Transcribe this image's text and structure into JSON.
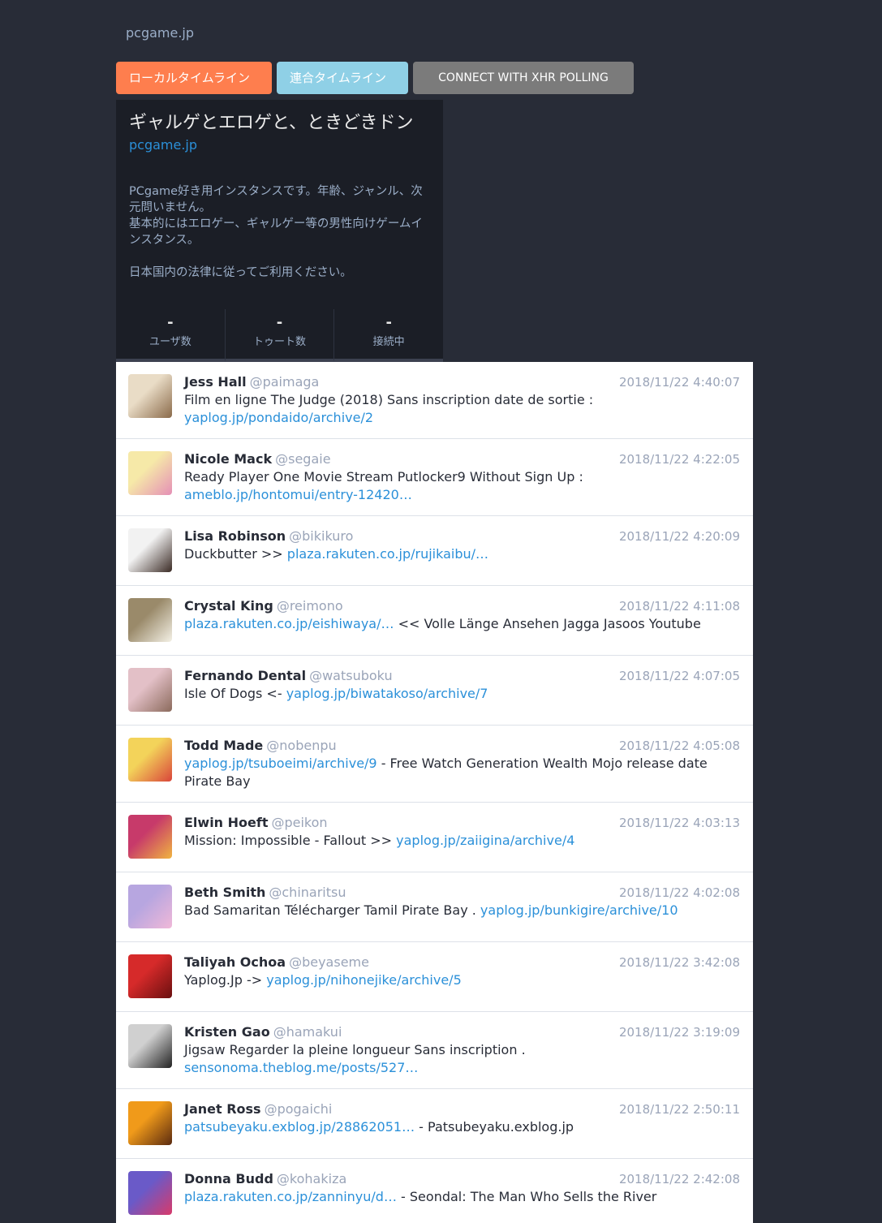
{
  "site": {
    "name": "pcgame.jp"
  },
  "tabs": {
    "local": "ローカルタイムライン",
    "federated": "連合タイムライン",
    "connect": "CONNECT WITH XHR POLLING"
  },
  "instance": {
    "title": "ギャルゲとエロゲと、ときどきドン",
    "link": "pcgame.jp",
    "desc_line1": "PCgame好き用インスタンスです。年齢、ジャンル、次元問いません。",
    "desc_line2": "基本的にはエロゲー、ギャルゲー等の男性向けゲームインスタンス。",
    "desc_line3": "日本国内の法律に従ってご利用ください。",
    "stats": [
      {
        "value": "-",
        "label": "ユーザ数"
      },
      {
        "value": "-",
        "label": "トゥート数"
      },
      {
        "value": "-",
        "label": "接続中"
      }
    ]
  },
  "statuses": [
    {
      "name": "Jess Hall",
      "acct": "@paimaga",
      "time": "2018/11/22 4:40:07",
      "parts": [
        {
          "t": "text",
          "v": "Film en ligne The Judge (2018) Sans inscription date de sortie : "
        },
        {
          "t": "link",
          "v": "yaplog.jp/pondaido/archive/2"
        }
      ],
      "avatar": [
        "#e9dcc6",
        "#8a6a4a"
      ]
    },
    {
      "name": "Nicole Mack",
      "acct": "@segaie",
      "time": "2018/11/22 4:22:05",
      "parts": [
        {
          "t": "text",
          "v": "Ready Player One Movie Stream Putlocker9 Without Sign Up : "
        },
        {
          "t": "link",
          "v": "ameblo.jp/hontomui/entry-12420…"
        }
      ],
      "avatar": [
        "#f6e9a8",
        "#e58fb6"
      ]
    },
    {
      "name": "Lisa Robinson",
      "acct": "@bikikuro",
      "time": "2018/11/22 4:20:09",
      "parts": [
        {
          "t": "text",
          "v": "Duckbutter >> "
        },
        {
          "t": "link",
          "v": "plaza.rakuten.co.jp/rujikaibu/…"
        }
      ],
      "avatar": [
        "#f2f2f2",
        "#3a2a24"
      ]
    },
    {
      "name": "Crystal King",
      "acct": "@reimono",
      "time": "2018/11/22 4:11:08",
      "parts": [
        {
          "t": "link",
          "v": "plaza.rakuten.co.jp/eishiwaya/…"
        },
        {
          "t": "text",
          "v": " << Volle Länge Ansehen Jagga Jasoos Youtube"
        }
      ],
      "avatar": [
        "#9a8a6a",
        "#f4f1e6"
      ]
    },
    {
      "name": "Fernando Dental",
      "acct": "@watsuboku",
      "time": "2018/11/22 4:07:05",
      "parts": [
        {
          "t": "text",
          "v": "Isle Of Dogs <- "
        },
        {
          "t": "link",
          "v": "yaplog.jp/biwatakoso/archive/7"
        }
      ],
      "avatar": [
        "#e3c0c7",
        "#8b6a5c"
      ]
    },
    {
      "name": "Todd Made",
      "acct": "@nobenpu",
      "time": "2018/11/22 4:05:08",
      "parts": [
        {
          "t": "link",
          "v": "yaplog.jp/tsuboeimi/archive/9"
        },
        {
          "t": "text",
          "v": " - Free Watch Generation Wealth Mojo release date Pirate Bay"
        }
      ],
      "avatar": [
        "#f3d35a",
        "#d9453a"
      ]
    },
    {
      "name": "Elwin Hoeft",
      "acct": "@peikon",
      "time": "2018/11/22 4:03:13",
      "parts": [
        {
          "t": "text",
          "v": "Mission: Impossible - Fallout >> "
        },
        {
          "t": "link",
          "v": "yaplog.jp/zaiigina/archive/4"
        }
      ],
      "avatar": [
        "#c73a6a",
        "#f0b440"
      ]
    },
    {
      "name": "Beth Smith",
      "acct": "@chinaritsu",
      "time": "2018/11/22 4:02:08",
      "parts": [
        {
          "t": "text",
          "v": "Bad Samaritan Télécharger Tamil Pirate Bay . "
        },
        {
          "t": "link",
          "v": "yaplog.jp/bunkigire/archive/10"
        }
      ],
      "avatar": [
        "#b7a6e0",
        "#f0b8d8"
      ]
    },
    {
      "name": "Taliyah Ochoa",
      "acct": "@beyaseme",
      "time": "2018/11/22 3:42:08",
      "parts": [
        {
          "t": "text",
          "v": "Yaplog.Jp -> "
        },
        {
          "t": "link",
          "v": "yaplog.jp/nihonejike/archive/5"
        }
      ],
      "avatar": [
        "#d62a2a",
        "#6a0f0f"
      ]
    },
    {
      "name": "Kristen Gao",
      "acct": "@hamakui",
      "time": "2018/11/22 3:19:09",
      "parts": [
        {
          "t": "text",
          "v": "Jigsaw Regarder la pleine longueur Sans inscription . "
        },
        {
          "t": "link",
          "v": "sensonoma.theblog.me/posts/527…"
        }
      ],
      "avatar": [
        "#d0d0d0",
        "#222222"
      ]
    },
    {
      "name": "Janet Ross",
      "acct": "@pogaichi",
      "time": "2018/11/22 2:50:11",
      "parts": [
        {
          "t": "link",
          "v": "patsubeyaku.exblog.jp/28862051…"
        },
        {
          "t": "text",
          "v": " - Patsubeyaku.exblog.jp"
        }
      ],
      "avatar": [
        "#f09a1a",
        "#5a2a10"
      ]
    },
    {
      "name": "Donna Budd",
      "acct": "@kohakiza",
      "time": "2018/11/22 2:42:08",
      "parts": [
        {
          "t": "link",
          "v": "plaza.rakuten.co.jp/zanninyu/d…"
        },
        {
          "t": "text",
          "v": " - Seondal: The Man Who Sells the River"
        }
      ],
      "avatar": [
        "#6a5ac8",
        "#d83a6a"
      ]
    }
  ]
}
